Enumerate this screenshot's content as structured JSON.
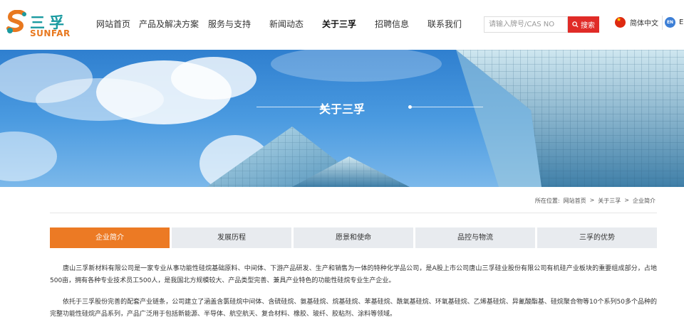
{
  "brand": {
    "name_cn": "三孚",
    "name_en": "SUNFAR",
    "colors": {
      "teal": "#1a9aa0",
      "orange": "#e8781f"
    }
  },
  "nav": {
    "items": [
      {
        "label": "网站首页"
      },
      {
        "label": "产品及解决方案"
      },
      {
        "label": "服务与支持"
      },
      {
        "label": "新闻动态"
      },
      {
        "label": "关于三孚"
      },
      {
        "label": "招聘信息"
      },
      {
        "label": "联系我们"
      }
    ],
    "active": "关于三孚"
  },
  "search": {
    "placeholder": "请输入牌号/CAS NO",
    "button_label": "搜索",
    "icon": "search-icon"
  },
  "language": {
    "cn_label": "简体中文",
    "en_badge": "EN",
    "en_label": "E"
  },
  "banner": {
    "title": "关于三孚"
  },
  "breadcrumb": {
    "prefix": "所在位置:",
    "items": [
      "网站首页",
      ">",
      "关于三孚",
      ">",
      "企业简介"
    ]
  },
  "tabs": {
    "items": [
      {
        "label": "企业简介"
      },
      {
        "label": "发展历程"
      },
      {
        "label": "愿景和使命"
      },
      {
        "label": "品控与物流"
      },
      {
        "label": "三孚的优势"
      }
    ],
    "active_color": "#ec7a24"
  },
  "content": {
    "paragraphs": [
      "唐山三孚新材料有限公司是一家专业从事功能性硅烷基础原料、中间体、下游产品研发、生产和销售为一体的特种化学品公司，是A股上市公司唐山三孚硅业股份有限公司有机硅产业板块的重要组成部分，占地500亩，拥有各种专业技术员工500人，是我国北方规模较大、产品类型完善、兼具产业特色的功能性硅烷专业生产企业。",
      "依托于三孚股份完善的配套产业链条，公司建立了涵盖含氯硅烷中间体、含硫硅烷、氨基硅烷、烷基硅烷、苯基硅烷、酰氧基硅烷、环氧基硅烷、乙烯基硅烷、异氰酸酯基、硅烷聚合物等10个系列50多个品种的完整功能性硅烷产品系列，产品广泛用于包括新能源、半导体、航空航天、复合材料、橡胶、玻纤、胶粘剂、涂料等领域。"
    ]
  }
}
